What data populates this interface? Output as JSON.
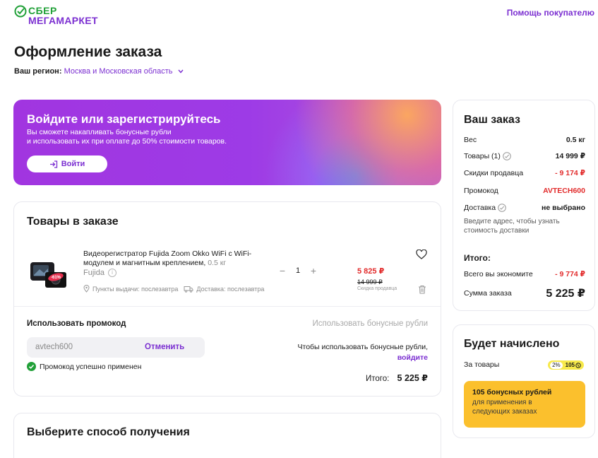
{
  "header": {
    "logo_line1": "СБЕР",
    "logo_line2": "МЕГАМАРКЕТ",
    "help_link": "Помощь покупателю"
  },
  "page": {
    "title": "Оформление заказа",
    "region_label": "Ваш регион:",
    "region_value": "Москва и Московская область"
  },
  "banner": {
    "title": "Войдите или зарегистрируйтесь",
    "text_line1": "Вы сможете накапливать бонусные рубли",
    "text_line2": "и использовать их при оплате до 50% стоимости товаров.",
    "login_label": "Войти"
  },
  "items": {
    "title": "Товары в заказе",
    "product": {
      "image_badge": "-61%",
      "name": "Видеорегистратор Fujida Zoom Okko WiFi с WiFi-модулем и магнитным креплением,",
      "weight": "0.5 кг",
      "brand": "Fujida",
      "pickup": "Пункты выдачи: послезавтра",
      "delivery": "Доставка: послезавтра",
      "quantity": "1",
      "price_new": "5 825 ₽",
      "price_old": "14 999 ₽",
      "price_note": "Скидка продавца"
    },
    "promo_label": "Использовать промокод",
    "bonus_link": "Использовать бонусные рубли",
    "promo_code": "avtech600",
    "promo_cancel": "Отменить",
    "promo_success": "Промокод успешно применен",
    "bonus_note_line1": "Чтобы использовать бонусные рубли,",
    "bonus_note_login": "войдите",
    "total_label": "Итого:",
    "total_value": "5 225 ₽"
  },
  "shipping": {
    "title": "Выберите способ получения"
  },
  "summary": {
    "title": "Ваш заказ",
    "weight_label": "Вес",
    "weight_value": "0.5 кг",
    "goods_label": "Товары (1)",
    "goods_value": "14 999 ₽",
    "seller_discount_label": "Скидки продавца",
    "seller_discount_value": "- 9 174 ₽",
    "promo_label": "Промокод",
    "promo_value": "AVTECH600",
    "delivery_label": "Доставка",
    "delivery_value": "не выбрано",
    "address_note": "Введите адрес, чтобы узнать стоимость доставки",
    "total_label": "Итого:",
    "savings_label": "Всего вы экономите",
    "savings_value": "- 9 774 ₽",
    "order_sum_label": "Сумма заказа",
    "order_sum_value": "5 225 ₽"
  },
  "bonus": {
    "title": "Будет начислено",
    "for_goods": "За товары",
    "percent": "2%",
    "amount": "105",
    "box_title": "105 бонусных рублей",
    "box_text": "для применения в следующих заказах"
  },
  "colors": {
    "brand_purple": "#7b2fd1",
    "brand_green": "#21a038",
    "price_red": "#e22b2b",
    "bonus_yellow": "#fbc02d"
  }
}
